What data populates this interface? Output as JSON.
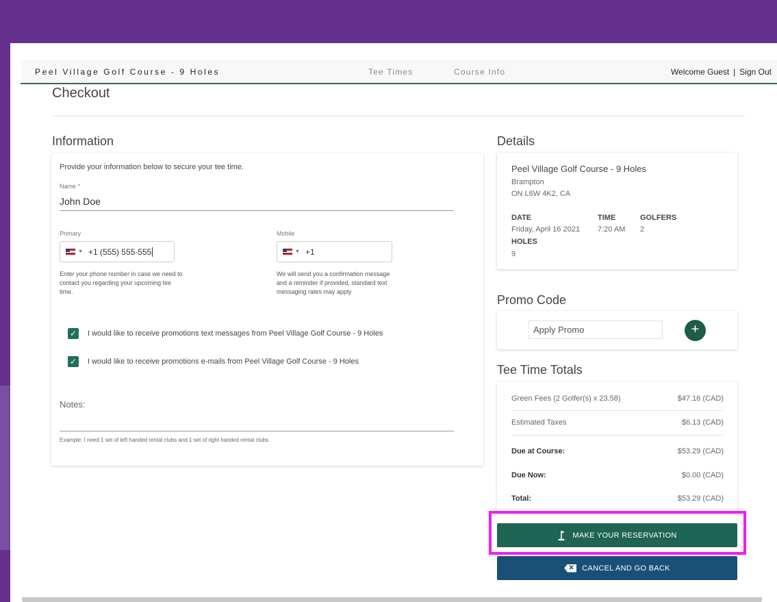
{
  "nav": {
    "brand": "Peel Village Golf Course - 9 Holes",
    "tee_times": "Tee Times",
    "course_info": "Course Info",
    "welcome": "Welcome Guest",
    "separator": "|",
    "sign_out": "Sign Out"
  },
  "page": {
    "title": "Checkout"
  },
  "information": {
    "title": "Information",
    "intro": "Provide your information below to secure your tee time.",
    "name_label": "Name *",
    "name_value": "John Doe",
    "primary_label": "Primary",
    "primary_value": "+1 (555) 555-555",
    "primary_hint": "Enter your phone number in case we need to contact you regarding your upcoming tee time.",
    "mobile_label": "Mobile",
    "mobile_value": "+1",
    "mobile_hint": "We will send you a confirmation message and a reminder if provided, standard text messaging rates may apply",
    "sms_opt_in": "I would like to receive promotions text messages from Peel Village Golf Course - 9 Holes",
    "sms_checked": true,
    "email_opt_in": "I would like to receive promotions e-mails from Peel Village Golf Course - 9 Holes",
    "email_checked": true,
    "notes_label": "Notes:",
    "notes_hint": "Example: I need 1 set of left handed rental clubs and 1 set of right handed rental clubs."
  },
  "details": {
    "title": "Details",
    "course": "Peel Village Golf Course - 9 Holes",
    "city": "Brampton",
    "postal": "ON L6W 4K2, CA",
    "date_label": "DATE",
    "date_value": "Friday, April 16 2021",
    "time_label": "TIME",
    "time_value": "7:20 AM",
    "golfers_label": "GOLFERS",
    "golfers_value": "2",
    "holes_label": "HOLES",
    "holes_value": "9"
  },
  "promo": {
    "title": "Promo Code",
    "placeholder": "Apply Promo",
    "add_symbol": "+"
  },
  "totals": {
    "title": "Tee Time Totals",
    "green_fees_label": "Green Fees (2 Golfer(s) x 23.58)",
    "green_fees_value": "$47.16 (CAD)",
    "taxes_label": "Estimated Taxes",
    "taxes_value": "$6.13 (CAD)",
    "due_course_label": "Due at Course:",
    "due_course_value": "$53.29 (CAD)",
    "due_now_label": "Due Now:",
    "due_now_value": "$0.00 (CAD)",
    "total_label": "Total:",
    "total_value": "$53.29 (CAD)"
  },
  "actions": {
    "reserve": "MAKE YOUR RESERVATION",
    "cancel": "CANCEL AND GO BACK"
  },
  "colors": {
    "background": "#652f8d",
    "primary_green": "#1e6553",
    "cancel_blue": "#1a4f78",
    "highlight": "#f21cf2"
  }
}
